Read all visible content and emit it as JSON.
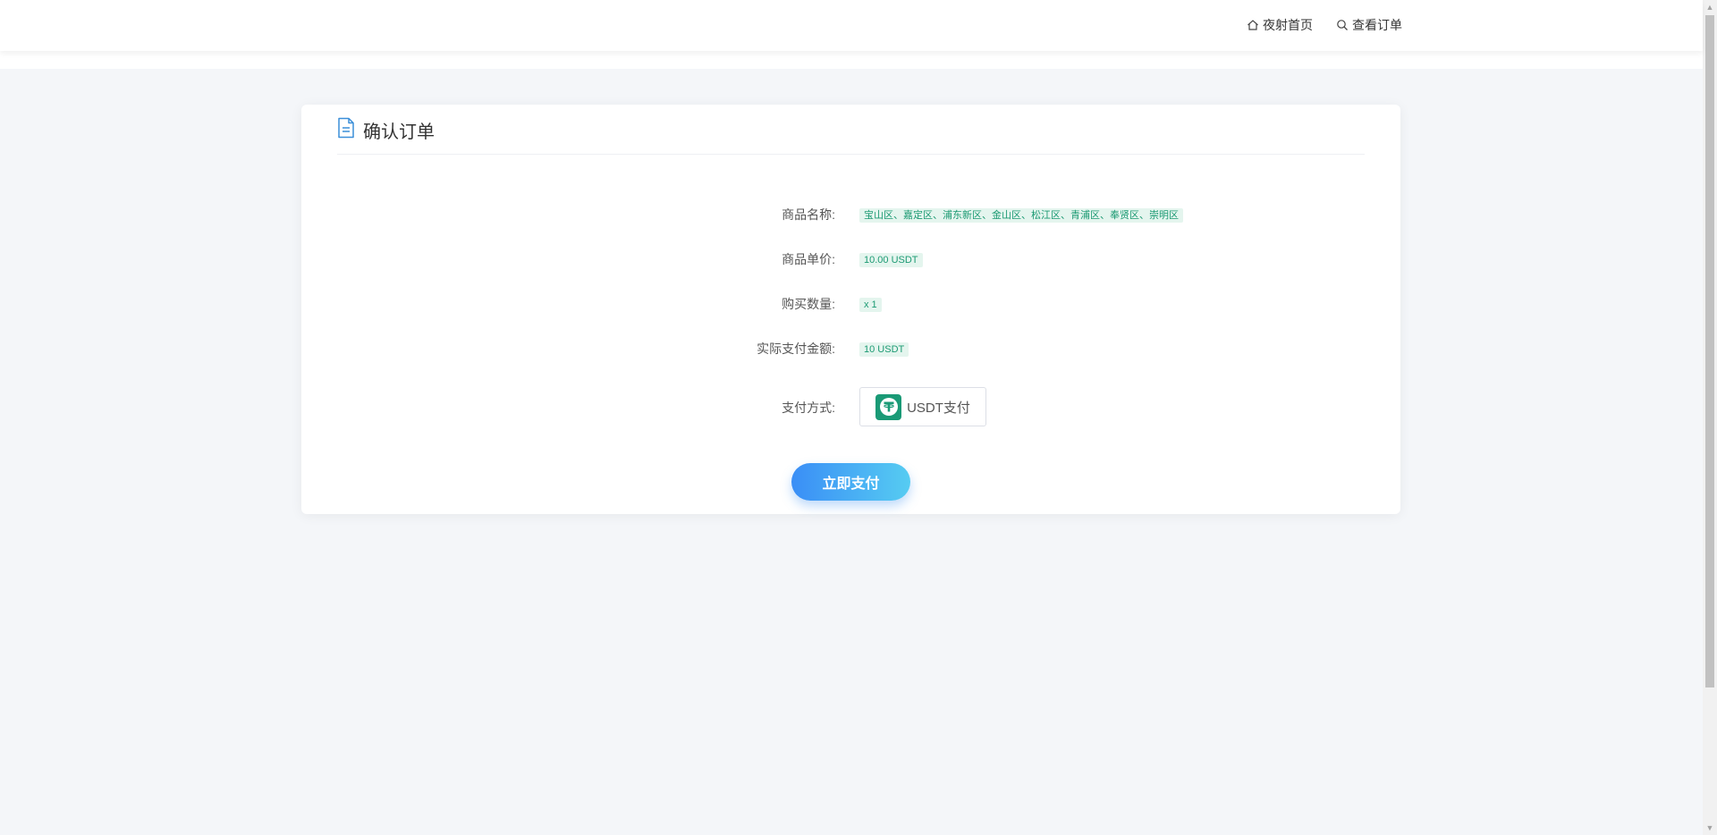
{
  "header": {
    "nav_home": "夜射首页",
    "nav_orders": "查看订单"
  },
  "card": {
    "title": "确认订单",
    "rows": [
      {
        "label": "商品名称:",
        "value": "宝山区、嘉定区、浦东新区、金山区、松江区、青浦区、奉贤区、崇明区"
      },
      {
        "label": "商品单价:",
        "value": "10.00 USDT"
      },
      {
        "label": "购买数量:",
        "value": "x 1"
      },
      {
        "label": "实际支付金额:",
        "value": "10 USDT"
      }
    ],
    "payment_label": "支付方式:",
    "payment_method": "USDT支付",
    "pay_button": "立即支付"
  },
  "colors": {
    "accent_gradient_start": "#3a8ef6",
    "accent_gradient_end": "#56ccf2",
    "tag_text": "#1c9a73",
    "tag_bg": "#e4f5ee",
    "usdt_green": "#1a9a76"
  },
  "icons": {
    "home": "home-icon",
    "search": "search-icon",
    "document": "document-icon",
    "usdt": "tether-logo"
  }
}
